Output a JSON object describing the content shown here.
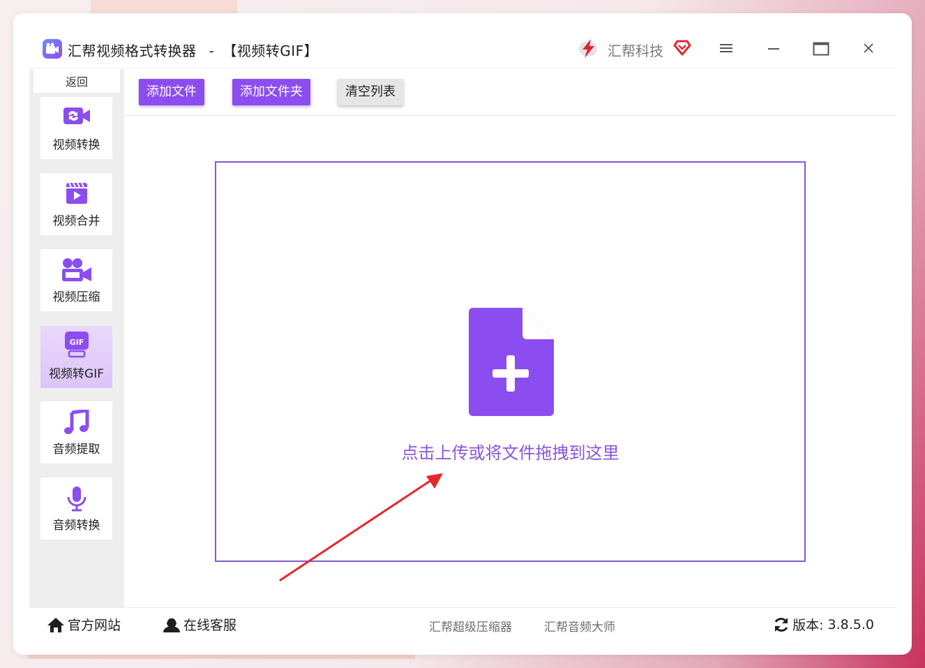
{
  "app": {
    "title": "汇帮视频格式转换器",
    "separator": "-",
    "mode": "【视频转GIF】",
    "brand_name": "汇帮科技"
  },
  "sidebar": {
    "back_label": "返回",
    "items": [
      {
        "label": "视频转换",
        "icon": "video-convert-icon"
      },
      {
        "label": "视频合并",
        "icon": "video-merge-icon"
      },
      {
        "label": "视频压缩",
        "icon": "video-compress-icon"
      },
      {
        "label": "视频转GIF",
        "icon": "gif-icon",
        "active": true
      },
      {
        "label": "音频提取",
        "icon": "music-note-icon"
      },
      {
        "label": "音频转换",
        "icon": "microphone-icon"
      }
    ]
  },
  "toolbar": {
    "add_file": "添加文件",
    "add_folder": "添加文件夹",
    "clear_list": "清空列表"
  },
  "dropzone": {
    "text": "点击上传或将文件拖拽到这里"
  },
  "footer": {
    "official_site": "官方网站",
    "online_support": "在线客服",
    "link_compressor": "汇帮超级压缩器",
    "link_audio": "汇帮音频大师",
    "version_label": "版本:",
    "version_value": "3.8.5.0"
  },
  "colors": {
    "accent": "#8b4df0",
    "drop_border": "#8358d0",
    "drop_text": "#8a53df",
    "arrow": "#e8262a"
  }
}
